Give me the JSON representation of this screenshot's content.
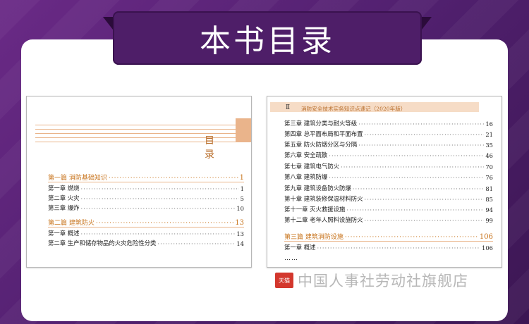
{
  "banner": {
    "title": "本书目录"
  },
  "left_page": {
    "heading": "目 录",
    "entries": [
      {
        "label": "第一篇  消防基础知识",
        "page": "1",
        "type": "part"
      },
      {
        "label": "第一章   燃烧",
        "page": "1",
        "type": "chapter"
      },
      {
        "label": "第二章   火灾",
        "page": "5",
        "type": "chapter"
      },
      {
        "label": "第三章   爆炸",
        "page": "10",
        "type": "chapter"
      },
      {
        "label": "第二篇  建筑防火",
        "page": "13",
        "type": "part"
      },
      {
        "label": "第一章   概述",
        "page": "13",
        "type": "chapter"
      },
      {
        "label": "第二章   生产和储存物品的火灾危险性分类",
        "page": "14",
        "type": "chapter"
      }
    ]
  },
  "right_page": {
    "header_roman": "Ⅱ",
    "header_text": "消防安全技术实务知识点速记（2020年版）",
    "entries": [
      {
        "label": "第三章   建筑分类与耐火等级",
        "page": "16",
        "type": "chapter"
      },
      {
        "label": "第四章   总平面布局和平面布置",
        "page": "21",
        "type": "chapter"
      },
      {
        "label": "第五章   防火防烟分区与分隔",
        "page": "35",
        "type": "chapter"
      },
      {
        "label": "第六章   安全疏散",
        "page": "46",
        "type": "chapter"
      },
      {
        "label": "第七章   建筑电气防火",
        "page": "70",
        "type": "chapter"
      },
      {
        "label": "第八章   建筑防爆",
        "page": "76",
        "type": "chapter"
      },
      {
        "label": "第九章   建筑设备防火防爆",
        "page": "81",
        "type": "chapter"
      },
      {
        "label": "第十章   建筑装修保温材料防火",
        "page": "85",
        "type": "chapter"
      },
      {
        "label": "第十一章   灭火救援设施",
        "page": "94",
        "type": "chapter"
      },
      {
        "label": "第十二章   老年人照料设施防火",
        "page": "99",
        "type": "chapter"
      },
      {
        "label": "第三篇  建筑消防设施",
        "page": "106",
        "type": "part"
      },
      {
        "label": "第一章   概述",
        "page": "106",
        "type": "chapter"
      }
    ],
    "ellipsis": "……"
  },
  "footer": {
    "tmall_icon_text": "天猫",
    "shop_name": "中国人事社劳动社旗舰店"
  },
  "colors": {
    "background": "#5a2277",
    "banner": "#4e1e68",
    "accent": "#c8741d"
  }
}
